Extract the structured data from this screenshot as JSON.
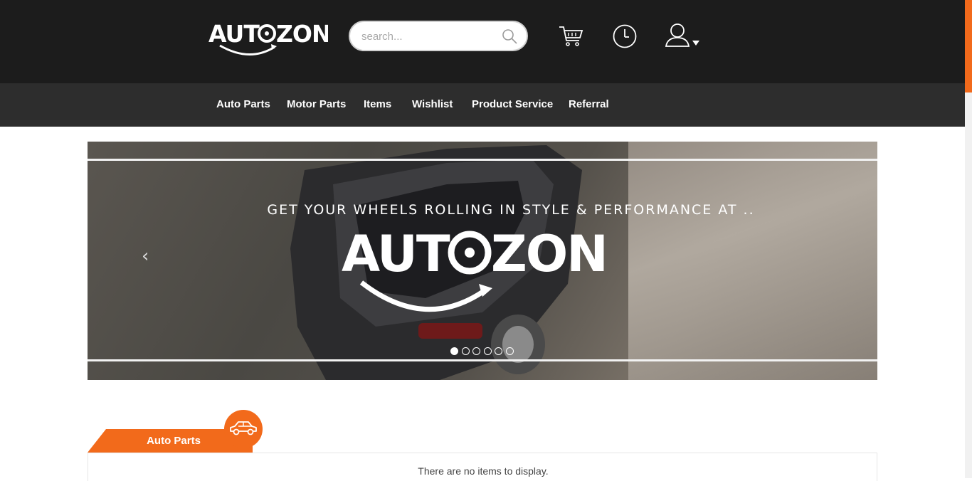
{
  "header": {
    "logo_text": "AUTOZON",
    "search": {
      "placeholder": "search..."
    },
    "icons": [
      "search-icon",
      "cart-icon",
      "clock-icon",
      "user-icon",
      "caret-down-icon"
    ]
  },
  "nav": {
    "items": [
      {
        "label": "Auto Parts"
      },
      {
        "label": "Motor Parts"
      },
      {
        "label": "Items"
      },
      {
        "label": "Wishlist"
      },
      {
        "label": "Product Service"
      },
      {
        "label": "Referral"
      }
    ]
  },
  "banner": {
    "tagline": "GET YOUR WHEELS ROLLING IN STYLE & PERFORMANCE AT ..",
    "logo_text": "AUTOZON",
    "slide_count": 6,
    "active_slide": 1
  },
  "section": {
    "title": "Auto Parts",
    "icon": "car-icon",
    "empty_message": "There are no items to display."
  },
  "colors": {
    "header_bg": "#1c1c1c",
    "nav_bg": "#2d2d2d",
    "accent": "#f26a1b",
    "text_light": "#ffffff"
  }
}
